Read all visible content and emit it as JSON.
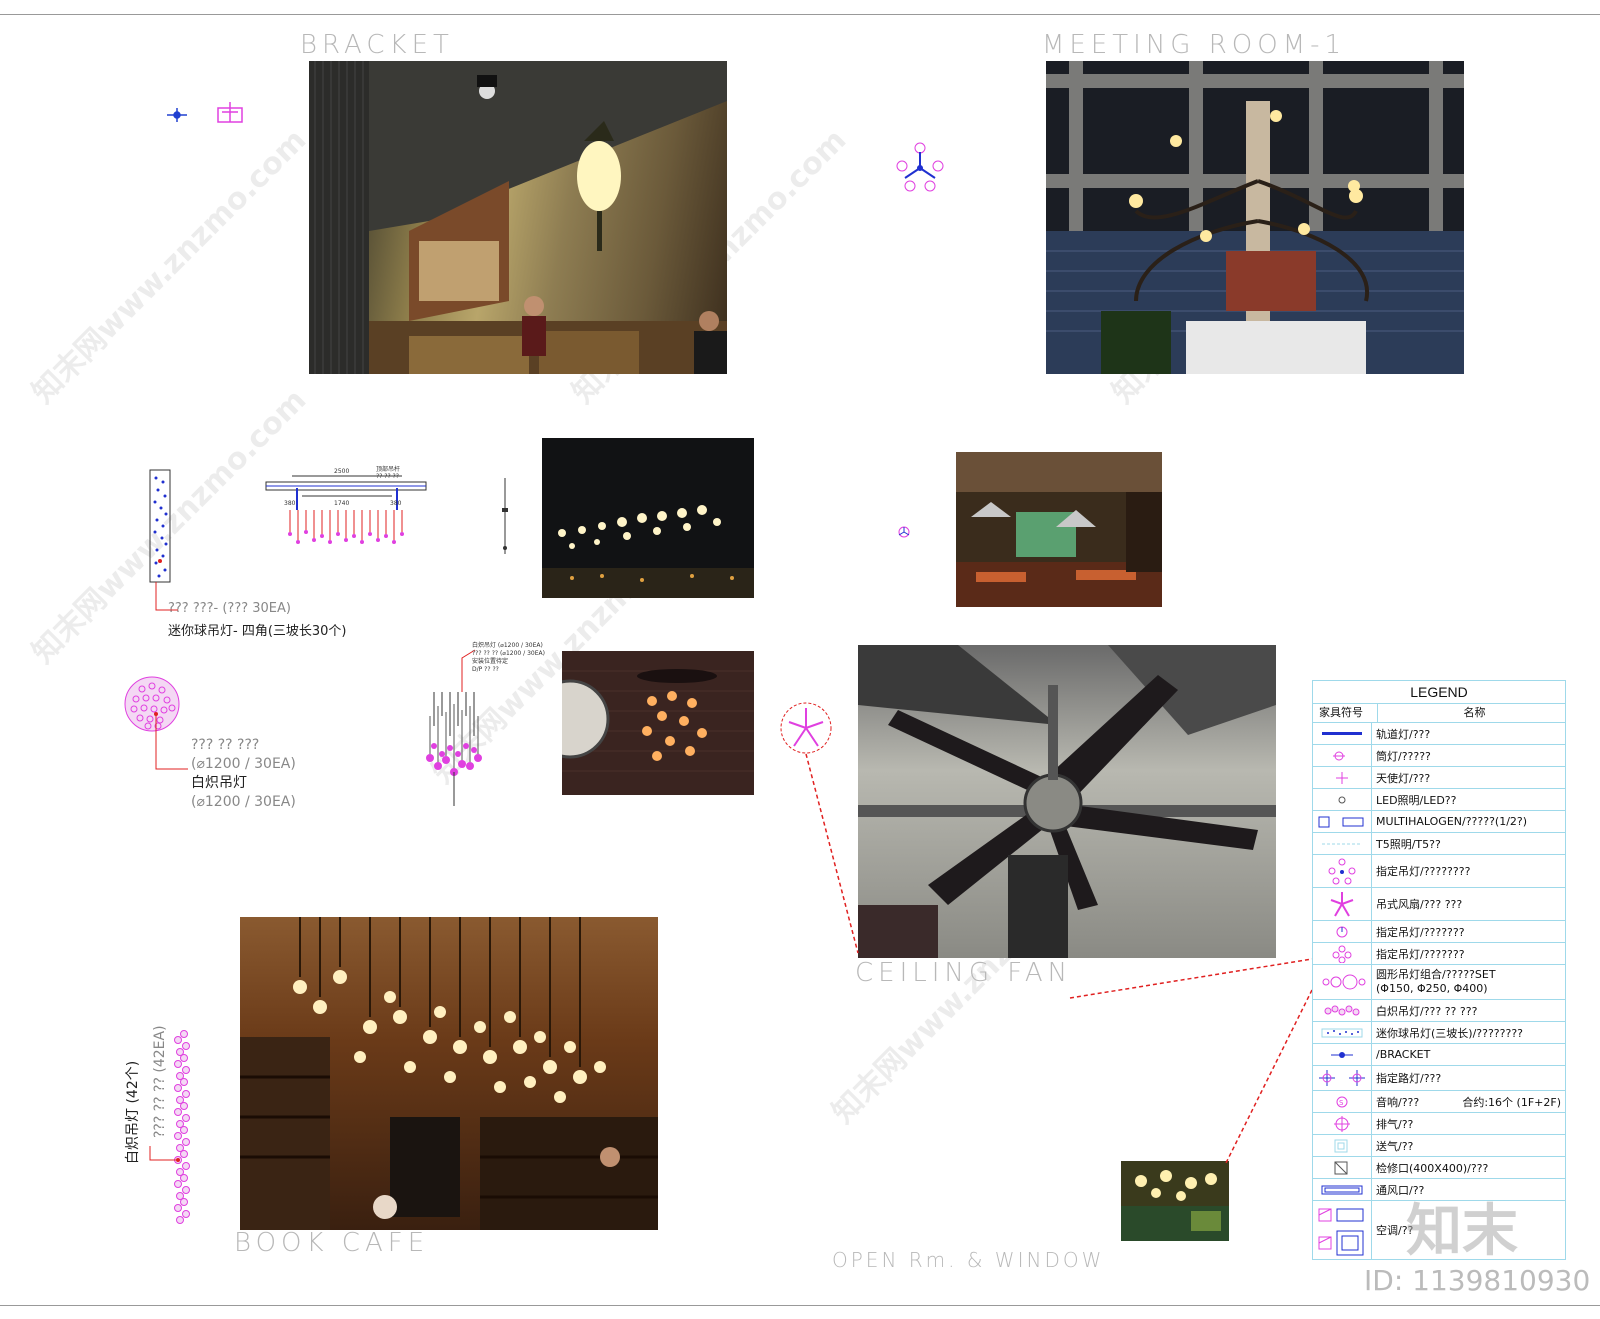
{
  "titles": {
    "bracket": "BRACKET",
    "meeting_room": "MEETING ROOM-1",
    "ceiling_fan": "CEILING FAN",
    "book_cafe": "BOOK CAFE",
    "open_room": "OPEN Rm. & WINDOW"
  },
  "notes": {
    "mini_ball_line1": "??? ???- (??? 30EA)",
    "mini_ball_line2": "迷你球吊灯- 四角(三坡长30个)",
    "incandescent_line1": "???  ?? ???",
    "incandescent_line2": "(⌀1200 / 30EA)",
    "incandescent_line3": "白炽吊灯",
    "incandescent_line4": "(⌀1200 / 30EA)",
    "vertical_cn": "白炽吊灯 (42个)",
    "vertical_q": "??? ?? ?? (42EA)"
  },
  "detail_labels": {
    "top_dim": "2500",
    "mid_dim": "1740",
    "left_dim": "380",
    "right_dim": "380",
    "ceiling_note": "顶部吊杆\n?? ?? ??",
    "pendant_note1": "白炽吊灯 (⌀1200 / 30EA)",
    "pendant_note2": "??? ?? ?? (⌀1200 / 30EA)",
    "pendant_note3": "安装位置待定",
    "pendant_note4": "D/P ?? ??"
  },
  "legend": {
    "title": "LEGEND",
    "col_symbol": "家具符号",
    "col_name": "名称",
    "rows": [
      {
        "label": "轨道灯/???",
        "icon": "track-light-icon"
      },
      {
        "label": "筒灯/?????",
        "icon": "downlight-icon"
      },
      {
        "label": "天使灯/???",
        "icon": "angel-light-icon"
      },
      {
        "label": "LED照明/LED??",
        "icon": "led-icon"
      },
      {
        "label": "MULTIHALOGEN/?????(1/2?)",
        "icon": "multihalogen-icon"
      },
      {
        "label": "T5照明/T5??",
        "icon": "t5-icon"
      },
      {
        "label": "指定吊灯/????????",
        "icon": "designated-pendant-icon"
      },
      {
        "label": "吊式风扇/??? ???",
        "icon": "ceiling-fan-icon"
      },
      {
        "label": "指定吊灯/???????",
        "icon": "designated-pendant-small-icon"
      },
      {
        "label": "指定吊灯/???????",
        "icon": "designated-pendant-flower-icon"
      },
      {
        "label": "圆形吊灯组合/?????SET",
        "label2": "(Φ150, Φ250, Φ400)",
        "icon": "round-pendant-set-icon"
      },
      {
        "label": "白炽吊灯/???  ?? ???",
        "icon": "incandescent-pendant-icon"
      },
      {
        "label": "迷你球吊灯(三坡长)/????????",
        "icon": "mini-ball-pendant-icon"
      },
      {
        "label": "/BRACKET",
        "icon": "bracket-icon"
      },
      {
        "label": "指定路灯/???",
        "icon": "street-light-icon"
      },
      {
        "label": "音响/???",
        "label_right": "合约:16个 (1F+2F)",
        "icon": "speaker-icon"
      },
      {
        "label": "排气/??",
        "icon": "exhaust-icon"
      },
      {
        "label": "送气/??",
        "icon": "supply-air-icon"
      },
      {
        "label": "检修口(400X400)/???",
        "icon": "access-panel-icon"
      },
      {
        "label": "通风口/??",
        "icon": "vent-icon"
      },
      {
        "label": "空调/??",
        "icon": "air-conditioner-icon"
      }
    ]
  },
  "watermark": {
    "site": "知末网www.znzmo.com",
    "brand": "知末",
    "id": "ID: 1139810930"
  },
  "colors": {
    "symbol_magenta": "#e040e0",
    "symbol_blue": "#2030d0",
    "leader_red": "#e02020",
    "legend_border": "#9fd9ea",
    "title_gray": "#b8b8b8"
  }
}
